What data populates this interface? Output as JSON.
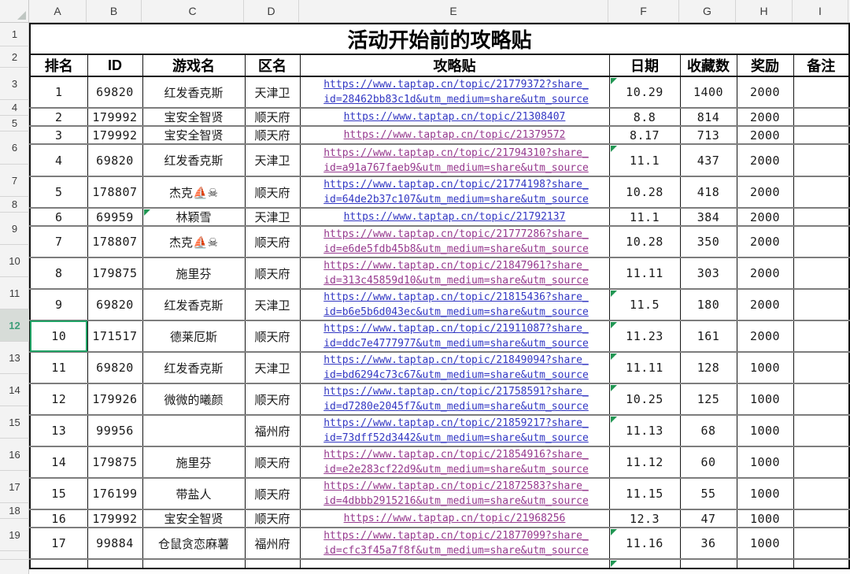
{
  "title": "活动开始前的攻略贴",
  "sheet": {
    "column_letters": [
      "A",
      "B",
      "C",
      "D",
      "E",
      "F",
      "G",
      "H",
      "I"
    ],
    "row_numbers": [
      "1",
      "2",
      "3",
      "4",
      "5",
      "6",
      "7",
      "8",
      "9",
      "10",
      "11",
      "12",
      "13",
      "14",
      "15",
      "16",
      "17",
      "18",
      "19",
      ""
    ],
    "selected_row_header": "12",
    "active_cell": "A12"
  },
  "table": {
    "headers": [
      "排名",
      "ID",
      "游戏名",
      "区名",
      "攻略贴",
      "日期",
      "收藏数",
      "奖励",
      "备注"
    ],
    "rows": [
      {
        "rank": "1",
        "id": "69820",
        "game": "红发香克斯",
        "region": "天津卫",
        "link_lines": [
          "https://www.taptap.cn/topic/21779372?share_",
          "id=28462bb83c1d&utm_medium=share&utm_source"
        ],
        "visited": false,
        "date": "10.29",
        "favorites": "1400",
        "reward": "2000",
        "note": "",
        "date_flag": true,
        "game_flag": false,
        "active": false
      },
      {
        "rank": "2",
        "id": "179992",
        "game": "宝安全智贤",
        "region": "顺天府",
        "link_lines": [
          "https://www.taptap.cn/topic/21308407"
        ],
        "visited": false,
        "date": "8.8",
        "favorites": "814",
        "reward": "2000",
        "note": "",
        "date_flag": false,
        "game_flag": false,
        "active": false
      },
      {
        "rank": "3",
        "id": "179992",
        "game": "宝安全智贤",
        "region": "顺天府",
        "link_lines": [
          "https://www.taptap.cn/topic/21379572"
        ],
        "visited": true,
        "date": "8.17",
        "favorites": "713",
        "reward": "2000",
        "note": "",
        "date_flag": false,
        "game_flag": false,
        "active": false
      },
      {
        "rank": "4",
        "id": "69820",
        "game": "红发香克斯",
        "region": "天津卫",
        "link_lines": [
          "https://www.taptap.cn/topic/21794310?share_",
          "id=a91a767faeb9&utm_medium=share&utm_source"
        ],
        "visited": true,
        "date": "11.1",
        "favorites": "437",
        "reward": "2000",
        "note": "",
        "date_flag": true,
        "game_flag": false,
        "active": false
      },
      {
        "rank": "5",
        "id": "178807",
        "game": "杰克⛵☠",
        "region": "顺天府",
        "link_lines": [
          "https://www.taptap.cn/topic/21774198?share_",
          "id=64de2b37c107&utm_medium=share&utm_source"
        ],
        "visited": false,
        "date": "10.28",
        "favorites": "418",
        "reward": "2000",
        "note": "",
        "date_flag": false,
        "game_flag": false,
        "active": false
      },
      {
        "rank": "6",
        "id": "69959",
        "game": "林颖雪",
        "region": "天津卫",
        "link_lines": [
          "https://www.taptap.cn/topic/21792137"
        ],
        "visited": false,
        "date": "11.1",
        "favorites": "384",
        "reward": "2000",
        "note": "",
        "date_flag": false,
        "game_flag": true,
        "active": false
      },
      {
        "rank": "7",
        "id": "178807",
        "game": "杰克⛵☠",
        "region": "顺天府",
        "link_lines": [
          "https://www.taptap.cn/topic/21777286?share_",
          "id=e6de5fdb45b8&utm_medium=share&utm_source"
        ],
        "visited": true,
        "date": "10.28",
        "favorites": "350",
        "reward": "2000",
        "note": "",
        "date_flag": false,
        "game_flag": false,
        "active": false
      },
      {
        "rank": "8",
        "id": "179875",
        "game": "施里芬",
        "region": "顺天府",
        "link_lines": [
          "https://www.taptap.cn/topic/21847961?share_",
          "id=313c45859d10&utm_medium=share&utm_source"
        ],
        "visited": true,
        "date": "11.11",
        "favorites": "303",
        "reward": "2000",
        "note": "",
        "date_flag": false,
        "game_flag": false,
        "active": false
      },
      {
        "rank": "9",
        "id": "69820",
        "game": "红发香克斯",
        "region": "天津卫",
        "link_lines": [
          "https://www.taptap.cn/topic/21815436?share_",
          "id=b6e5b6d043ec&utm_medium=share&utm_source"
        ],
        "visited": false,
        "date": "11.5",
        "favorites": "180",
        "reward": "2000",
        "note": "",
        "date_flag": true,
        "game_flag": false,
        "active": false
      },
      {
        "rank": "10",
        "id": "171517",
        "game": "德莱厄斯",
        "region": "顺天府",
        "link_lines": [
          "https://www.taptap.cn/topic/21911087?share_",
          "id=ddc7e4777977&utm_medium=share&utm_source"
        ],
        "visited": false,
        "date": "11.23",
        "favorites": "161",
        "reward": "2000",
        "note": "",
        "date_flag": true,
        "game_flag": false,
        "active": true
      },
      {
        "rank": "11",
        "id": "69820",
        "game": "红发香克斯",
        "region": "天津卫",
        "link_lines": [
          "https://www.taptap.cn/topic/21849094?share_",
          "id=bd6294c73c67&utm_medium=share&utm_source"
        ],
        "visited": false,
        "date": "11.11",
        "favorites": "128",
        "reward": "1000",
        "note": "",
        "date_flag": true,
        "game_flag": false,
        "active": false
      },
      {
        "rank": "12",
        "id": "179926",
        "game": "微微的曦颜",
        "region": "顺天府",
        "link_lines": [
          "https://www.taptap.cn/topic/21758591?share_",
          "id=d7280e2045f7&utm_medium=share&utm_source"
        ],
        "visited": false,
        "date": "10.25",
        "favorites": "125",
        "reward": "1000",
        "note": "",
        "date_flag": true,
        "game_flag": false,
        "active": false
      },
      {
        "rank": "13",
        "id": "99956",
        "game": "",
        "region": "福州府",
        "link_lines": [
          "https://www.taptap.cn/topic/21859217?share_",
          "id=73dff52d3442&utm_medium=share&utm_source"
        ],
        "visited": false,
        "date": "11.13",
        "favorites": "68",
        "reward": "1000",
        "note": "",
        "date_flag": true,
        "game_flag": false,
        "active": false
      },
      {
        "rank": "14",
        "id": "179875",
        "game": "施里芬",
        "region": "顺天府",
        "link_lines": [
          "https://www.taptap.cn/topic/21854916?share_",
          "id=e2e283cf22d9&utm_medium=share&utm_source"
        ],
        "visited": true,
        "date": "11.12",
        "favorites": "60",
        "reward": "1000",
        "note": "",
        "date_flag": false,
        "game_flag": false,
        "active": false
      },
      {
        "rank": "15",
        "id": "176199",
        "game": "带盐人",
        "region": "顺天府",
        "link_lines": [
          "https://www.taptap.cn/topic/21872583?share_",
          "id=4dbbb2915216&utm_medium=share&utm_source"
        ],
        "visited": true,
        "date": "11.15",
        "favorites": "55",
        "reward": "1000",
        "note": "",
        "date_flag": false,
        "game_flag": false,
        "active": false
      },
      {
        "rank": "16",
        "id": "179992",
        "game": "宝安全智贤",
        "region": "顺天府",
        "link_lines": [
          "https://www.taptap.cn/topic/21968256"
        ],
        "visited": true,
        "date": "12.3",
        "favorites": "47",
        "reward": "1000",
        "note": "",
        "date_flag": false,
        "game_flag": false,
        "active": false
      },
      {
        "rank": "17",
        "id": "99884",
        "game": "仓鼠贪恋麻薯",
        "region": "福州府",
        "link_lines": [
          "https://www.taptap.cn/topic/21877099?share_",
          "id=cfc3f45a7f8f&utm_medium=share&utm_source"
        ],
        "visited": true,
        "date": "11.16",
        "favorites": "36",
        "reward": "1000",
        "note": "",
        "date_flag": true,
        "game_flag": false,
        "active": false
      }
    ]
  },
  "colors": {
    "link_unvisited": "#3237c3",
    "link_visited": "#96398e",
    "error_indicator_green": "#219653",
    "active_cell_border": "#21a366",
    "selected_row_header_text": "#3f9e7a",
    "selected_row_header_bg": "#d7dcd8"
  }
}
